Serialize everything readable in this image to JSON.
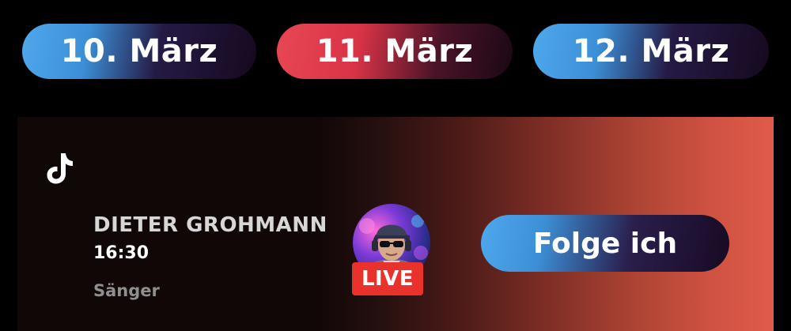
{
  "dates": [
    {
      "label": "10. März",
      "active": false
    },
    {
      "label": "11. März",
      "active": true
    },
    {
      "label": "12. März",
      "active": false
    }
  ],
  "event": {
    "platform_icon": "tiktok-icon",
    "artist_name": "DIETER GROHMANN",
    "time": "16:30",
    "role": "Sänger",
    "live_label": "LIVE",
    "follow_label": "Folge ich"
  },
  "colors": {
    "accent_blue": "#4fa8ec",
    "accent_red": "#e94755",
    "live_red": "#e8322b",
    "background": "#000000"
  }
}
